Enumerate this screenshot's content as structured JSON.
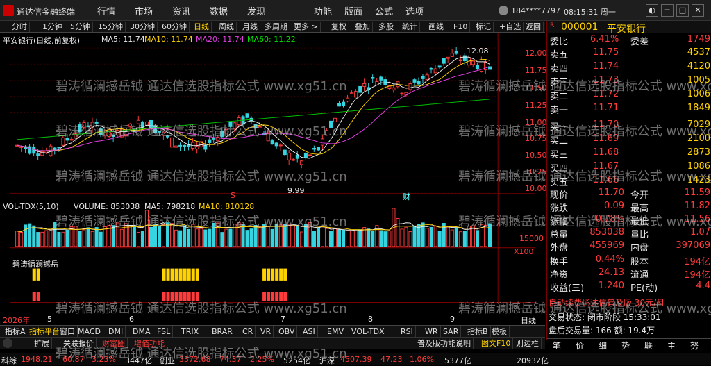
{
  "app": {
    "title": "通达信金融终端",
    "account": "184****7797",
    "time": "08:15:31 周一"
  },
  "menu": [
    "行情",
    "市场",
    "资讯",
    "数据",
    "发现",
    "功能",
    "版面",
    "公式",
    "选项"
  ],
  "toolbar": [
    "分时",
    "1分钟",
    "5分钟",
    "15分钟",
    "30分钟",
    "60分钟",
    "日线",
    "周线",
    "月线",
    "多周期",
    "更多 >",
    "复权",
    "叠加",
    "多股",
    "统计",
    "画线",
    "F10",
    "标记",
    "+自选",
    "返回"
  ],
  "main_legend": {
    "name": "平安银行(日线,前复权)",
    "ma5": "MA5: 11.74",
    "ma10": "MA10: 11.74",
    "ma20": "MA20: 11.74",
    "ma60": "MA60: 11.22"
  },
  "price_axis": [
    "12.00",
    "11.75",
    "11.50",
    "11.25",
    "11.00",
    "10.75",
    "10.50",
    "10.25",
    "10.00"
  ],
  "annotations": {
    "high": "12.08",
    "low": "9.99",
    "s_mark": "S",
    "cai_mark": "财"
  },
  "vol_legend": {
    "name": "VOL-TDX(5,10)",
    "volume": "VOLUME: 853038",
    "ma5": "MA5: 798218",
    "ma10": "MA10: 810128"
  },
  "vol_axis": [
    "15000",
    "X100"
  ],
  "indicator_legend": "碧涛循澜撼岳",
  "date_axis": [
    "2026年",
    "5",
    "6",
    "7",
    "8",
    "9",
    "日线"
  ],
  "bottom_tabs": [
    "指标A",
    "指标平台",
    "窗口",
    "MACD",
    "DMI",
    "DMA",
    "FSL",
    "TRIX",
    "BRAR",
    "CR",
    "VR",
    "OBV",
    "ASI",
    "EMV",
    "VOL-TDX",
    "RSI",
    "WR",
    "SAR",
    "指标B",
    "模板"
  ],
  "bottom_tabs2": [
    "扩展",
    "关联报价",
    "财富圈",
    "增值功能",
    "普及版功能说明",
    "图文F10",
    "则边栏"
  ],
  "quote": {
    "code": "000001",
    "name": "平安银行",
    "header": [
      {
        "l": "委比",
        "v": "6.41%",
        "l2": "委差",
        "v2": "1749"
      }
    ],
    "sells": [
      {
        "l": "卖五",
        "p": "11.75",
        "v": "4537"
      },
      {
        "l": "卖四",
        "p": "11.74",
        "v": "4120"
      },
      {
        "l": "卖三",
        "p": "11.73",
        "v": "1005"
      },
      {
        "l": "卖二",
        "p": "11.72",
        "v": "1006"
      },
      {
        "l": "卖一",
        "p": "11.71",
        "v": "1849"
      }
    ],
    "buys": [
      {
        "l": "买一",
        "p": "11.70",
        "v": "7029"
      },
      {
        "l": "买二",
        "p": "11.69",
        "v": "2100"
      },
      {
        "l": "买三",
        "p": "11.68",
        "v": "2873"
      },
      {
        "l": "买四",
        "p": "11.67",
        "v": "1086"
      },
      {
        "l": "买五",
        "p": "11.66",
        "v": "1423"
      }
    ],
    "stats": [
      {
        "l": "现价",
        "v": "11.70",
        "l2": "今开",
        "v2": "11.59"
      },
      {
        "l": "涨跌",
        "v": "0.09",
        "l2": "最高",
        "v2": "11.82"
      },
      {
        "l": "涨幅",
        "v": "0.78%",
        "l2": "最低",
        "v2": "11.56"
      },
      {
        "l": "总量",
        "v": "853038",
        "l2": "量比",
        "v2": "1.07"
      },
      {
        "l": "外盘",
        "v": "455969",
        "l2": "内盘",
        "v2": "397069"
      }
    ],
    "stats2": [
      {
        "l": "换手",
        "v": "0.44%",
        "l2": "股本",
        "v2": "194亿"
      },
      {
        "l": "净资",
        "v": "24.13",
        "l2": "流通",
        "v2": "194亿"
      },
      {
        "l": "收益(三)",
        "v": "1.240",
        "l2": "PE(动)",
        "v2": "4.4"
      }
    ],
    "promo": "自动续费通达信普及版 30元/月",
    "trade_state": "交易状态: 闭市阶段 15:33:01",
    "last_vol": "盘后交易量: 166 额: 19.4万",
    "footer": [
      "笔",
      "价",
      "细",
      "势",
      "联",
      "主",
      "努"
    ]
  },
  "statusbar": [
    "科综",
    "1948.21",
    "60.87",
    "3.23%",
    "3447亿",
    "创业",
    "3372.68",
    "74.37",
    "2.25%",
    "5254亿",
    "沪深",
    "4507.39",
    "47.23",
    "1.06%",
    "5377亿",
    "20932亿"
  ],
  "watermark": "碧涛循澜撼岳钺 通达信选股指标公式 www.xg51.cn"
}
